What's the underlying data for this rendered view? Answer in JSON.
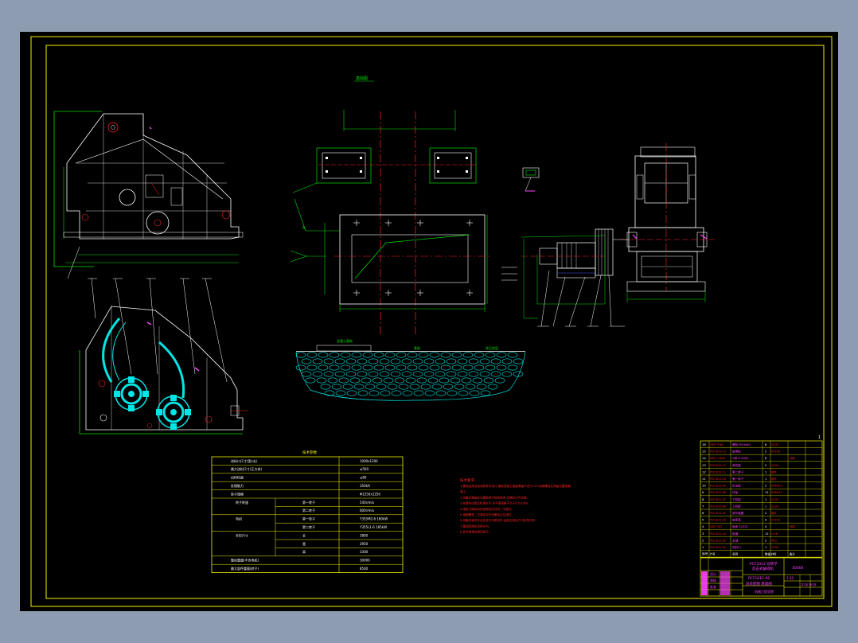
{
  "window": {
    "background_color": "#8d9cb0",
    "drawing_background": "#000000",
    "frame_color": "#f2f200"
  },
  "colors": {
    "yellow": "#f2f200",
    "white": "#ffffff",
    "red": "#ff2222",
    "green": "#00e000",
    "cyan": "#00e5e5",
    "magenta": "#ff44ff",
    "blue": "#4455ff"
  },
  "drawing": {
    "title": "基础图",
    "page_number": "1",
    "views": [
      {
        "name": "side-view",
        "icon": "crusher-side-elevation"
      },
      {
        "name": "section-view",
        "icon": "crusher-section-rotors"
      },
      {
        "name": "plan-view",
        "icon": "foundation-plan"
      },
      {
        "name": "front-view",
        "icon": "crusher-front-elevation"
      },
      {
        "name": "foundation-section",
        "icon": "gravel-hatch"
      }
    ],
    "foundation_labels": [
      "混凝土基础",
      "基础",
      "碎石垫层"
    ],
    "marker_text": "A"
  },
  "spec_table": {
    "title": "技术参数",
    "rows": [
      {
        "label": "进料口尺寸(宽x长)",
        "sub": "",
        "value": "1000x1200"
      },
      {
        "label": "最大进料尺寸(正方体)",
        "sub": "",
        "value": "≤500"
      },
      {
        "label": "出料粒度",
        "sub": "",
        "value": "≤80"
      },
      {
        "label": "处理能力",
        "sub": "",
        "value": "350t/h"
      },
      {
        "label": "转子规格",
        "sub": "",
        "value": "Φ1250x1250"
      },
      {
        "label": "转子转速",
        "sub": "第一转子",
        "value": "540r/min"
      },
      {
        "label": "",
        "sub": "第二转子",
        "value": "600r/min"
      },
      {
        "label": "电机",
        "sub": "第一转子",
        "value": "Y355M2-6 160kW"
      },
      {
        "label": "",
        "sub": "第二转子",
        "value": "Y355L1-6 185kW"
      },
      {
        "label": "外形尺寸",
        "sub": "长",
        "value": "3800"
      },
      {
        "label": "",
        "sub": "宽",
        "value": "2950"
      },
      {
        "label": "",
        "sub": "高",
        "value": "3300"
      },
      {
        "label": "整机重量(不含电机)",
        "sub": "",
        "value": "30000"
      },
      {
        "label": "最大部件重量(转子)",
        "sub": "",
        "value": "8500"
      }
    ]
  },
  "notes": {
    "heading": "技术要求:",
    "lines": [
      "1.基础应按当地地质条件设计,基础混凝土强度等级不低于C20,地脚螺栓孔预留位置准确。",
      "施工。",
      "2.设备安装前应对基础进行检查验收,合格后方可安装。",
      "3.安装时应保证机架水平,水平度误差不大于0.5/1000。",
      "4.电机与破碎机的皮带轮应在同一平面内。",
      "5.地脚螺栓二次灌浆应在设备找正后进行。",
      "6.设备安装完毕后应进行空载试车,运转正常后方可负载试车。",
      "7.基础四周应设排水沟。",
      "8.其余按相关规范执行。"
    ]
  },
  "parts_list": {
    "rows": [
      [
        "16",
        "GB/T 5782",
        "螺栓 M24x80",
        "8",
        "Q235",
        ""
      ],
      [
        "15",
        "PCF1012-13",
        "皮带轮",
        "2",
        "HT200",
        ""
      ],
      [
        "14",
        "GB/T 11544",
        "V带 D-5000",
        "8",
        "",
        "外购"
      ],
      [
        "13",
        "PCF1012-12",
        "电机座",
        "2",
        "Q235",
        ""
      ],
      [
        "12",
        "PCF1012-11",
        "第二转子",
        "1",
        "组件",
        ""
      ],
      [
        "11",
        "PCF1012-10",
        "第一转子",
        "1",
        "组件",
        ""
      ],
      [
        "10",
        "PCF1012-09",
        "反击板",
        "2",
        "ZGMn13",
        ""
      ],
      [
        "9",
        "PCF1012-08",
        "衬板",
        "12",
        "ZGMn13",
        ""
      ],
      [
        "8",
        "PCF1012-07",
        "下机架",
        "1",
        "Q235",
        ""
      ],
      [
        "7",
        "PCF1012-06",
        "上机架",
        "1",
        "Q235",
        ""
      ],
      [
        "6",
        "PCF1012-05",
        "调节装置",
        "2",
        "组件",
        ""
      ],
      [
        "5",
        "PCF1012-04",
        "轴承座",
        "4",
        "HT250",
        ""
      ],
      [
        "4",
        "GB/T 297",
        "轴承 22332",
        "4",
        "",
        "外购"
      ],
      [
        "3",
        "PCF1012-03",
        "板锤",
        "12",
        "Cr26",
        ""
      ],
      [
        "2",
        "PCF1012-02",
        "主轴",
        "2",
        "40Cr",
        ""
      ],
      [
        "1",
        "PCF1012-01",
        "进料口",
        "1",
        "Q235",
        ""
      ],
      [
        "序号",
        "代号",
        "名称",
        "数量",
        "材料",
        "备注"
      ]
    ]
  },
  "title_block": {
    "project": "PCF1012 双转子",
    "project2": "反击式破碎机",
    "drawing_no": "PCF1012-00",
    "drawing_name": "总装配图 基础图",
    "scale": "1:20",
    "sheet": "共1张 第1张",
    "designer": "设计",
    "checker": "审核",
    "approver": "批准",
    "weight": "30000",
    "school": "机械工程学院"
  }
}
